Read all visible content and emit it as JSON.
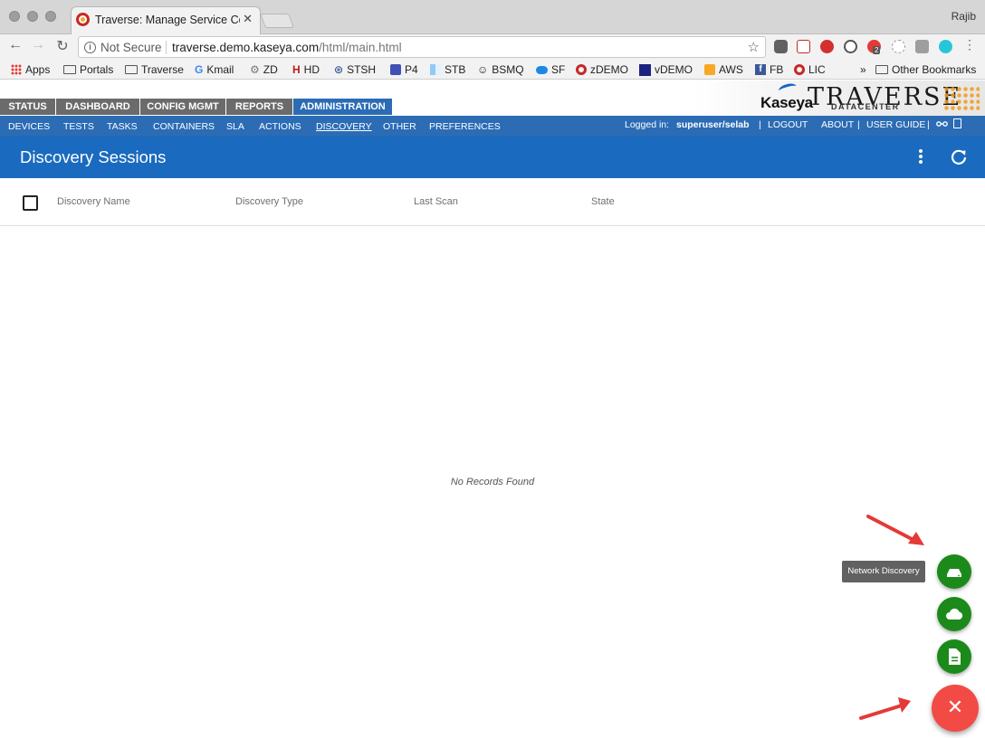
{
  "browser": {
    "tab_title": "Traverse: Manage Service Con",
    "profile_name": "Rajib",
    "security_label": "Not Secure",
    "url_host": "traverse.demo.kaseya.com",
    "url_path": "/html/main.html",
    "bookmarks": [
      {
        "label": "Apps",
        "icon": "apps-grid-icon"
      },
      {
        "label": "Portals",
        "icon": "folder-icon"
      },
      {
        "label": "Traverse",
        "icon": "folder-icon"
      },
      {
        "label": "Kmail",
        "icon": "google-icon"
      },
      {
        "label": "ZD",
        "icon": "gear-icon"
      },
      {
        "label": "HD",
        "icon": "hd-icon"
      },
      {
        "label": "STSH",
        "icon": "stsh-icon"
      },
      {
        "label": "P4",
        "icon": "p4-icon"
      },
      {
        "label": "STB",
        "icon": "stb-icon"
      },
      {
        "label": "BSMQ",
        "icon": "smiley-icon"
      },
      {
        "label": "SF",
        "icon": "cloud-icon"
      },
      {
        "label": "zDEMO",
        "icon": "traverse-icon"
      },
      {
        "label": "vDEMO",
        "icon": "kaseya-icon"
      },
      {
        "label": "AWS",
        "icon": "aws-icon"
      },
      {
        "label": "FB",
        "icon": "facebook-icon"
      },
      {
        "label": "LIC",
        "icon": "traverse-icon"
      }
    ],
    "overflow": "»",
    "other_bookmarks": "Other Bookmarks",
    "extension_badge": "2"
  },
  "app": {
    "main_tabs": [
      "STATUS",
      "DASHBOARD",
      "CONFIG MGMT",
      "REPORTS",
      "ADMINISTRATION"
    ],
    "logo_kaseya": "Kaseya",
    "logo_traverse": "TRAVERSE",
    "logo_datacenter": "DATACENTER",
    "sub_nav": [
      "DEVICES",
      "TESTS",
      "TASKS",
      "CONTAINERS",
      "SLA",
      "ACTIONS",
      "DISCOVERY",
      "OTHER",
      "PREFERENCES"
    ],
    "logged_in_label": "Logged in:",
    "user": "superuser/selab",
    "sep": "|",
    "logout": "LOGOUT",
    "about": "ABOUT",
    "user_guide": "USER GUIDE"
  },
  "page": {
    "title": "Discovery Sessions",
    "columns": [
      "Discovery Name",
      "Discovery Type",
      "Last Scan",
      "State"
    ],
    "empty_message": "No Records Found"
  },
  "fab": {
    "tooltip": "Network Discovery",
    "close_glyph": "✕",
    "colors": {
      "mini": "#1b8a1b",
      "main": "#f24b45"
    }
  }
}
